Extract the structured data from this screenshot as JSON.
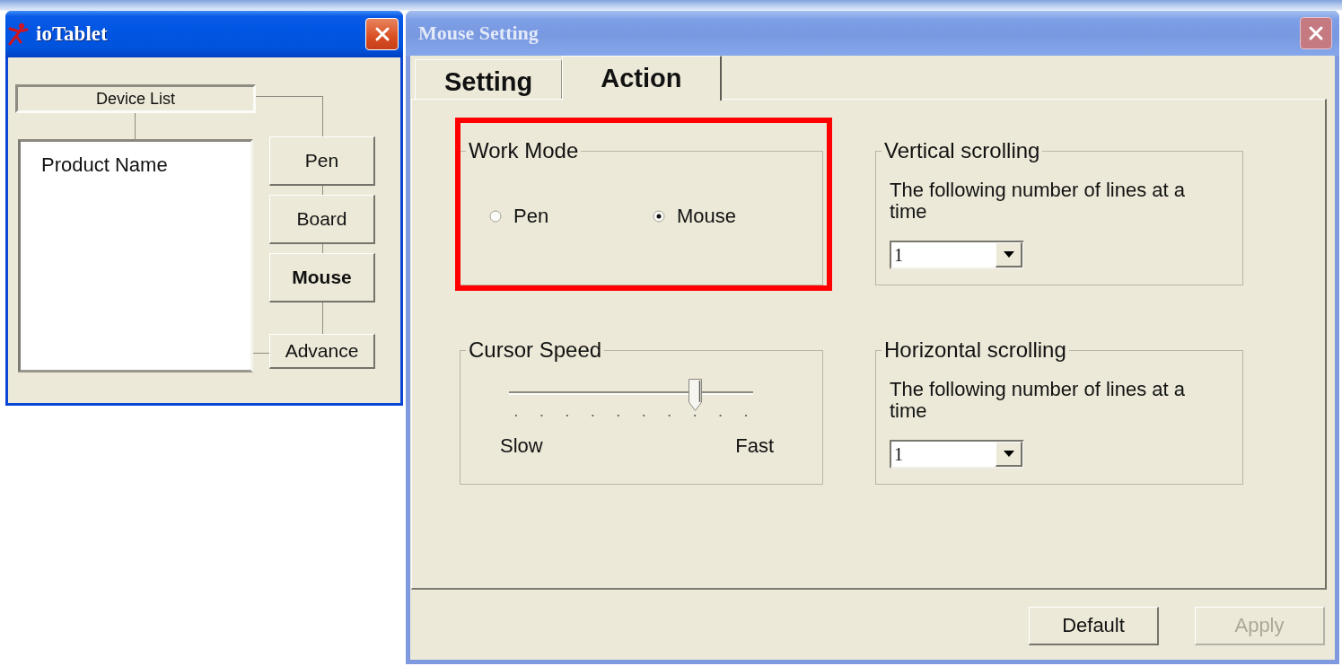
{
  "device_window": {
    "title": "ioTablet",
    "active": true,
    "list_label": "Device List",
    "devices": [
      {
        "name": "Product Name"
      }
    ],
    "nav_buttons": [
      {
        "label": "Pen",
        "selected": false
      },
      {
        "label": "Board",
        "selected": false
      },
      {
        "label": "Mouse",
        "selected": true
      },
      {
        "label": "Advance",
        "selected": false
      }
    ]
  },
  "mouse_window": {
    "title": "Mouse Setting",
    "active": false,
    "tabs": [
      {
        "label": "Setting",
        "selected": false
      },
      {
        "label": "Action",
        "selected": true
      }
    ],
    "work_mode": {
      "title": "Work Mode",
      "highlighted": true,
      "options": [
        {
          "label": "Pen",
          "selected": false
        },
        {
          "label": "Mouse",
          "selected": true
        }
      ]
    },
    "cursor_speed": {
      "title": "Cursor Speed",
      "level": 0.78,
      "min_label": "Slow",
      "max_label": "Fast"
    },
    "scrolling": [
      {
        "title": "Vertical scrolling",
        "description": "The following number of lines at a time",
        "value": "1"
      },
      {
        "title": "Horizontal scrolling",
        "description": "The following number of lines at a time",
        "value": "1"
      }
    ],
    "buttons": [
      {
        "label": "Default",
        "disabled": false
      },
      {
        "label": "Apply",
        "disabled": true
      }
    ]
  }
}
